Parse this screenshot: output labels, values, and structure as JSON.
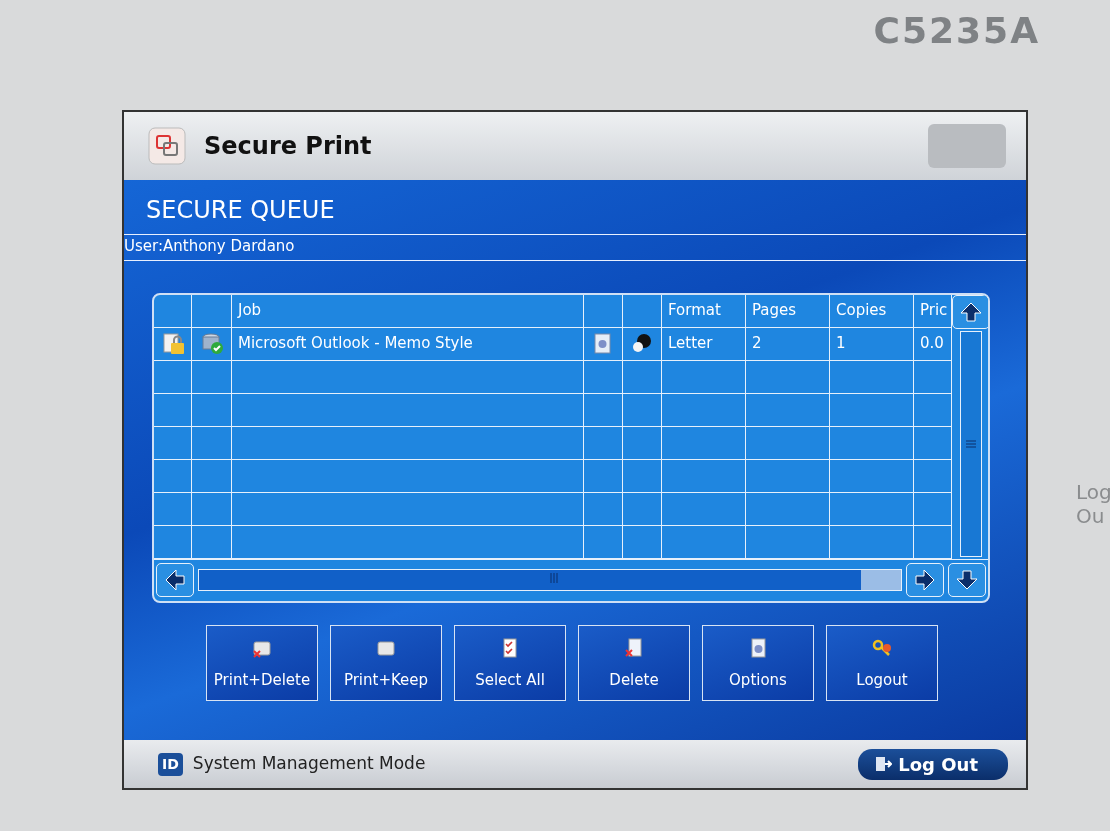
{
  "device": {
    "model": "C5235A",
    "side_text": [
      "Log",
      "Ou"
    ]
  },
  "header": {
    "title": "Secure Print"
  },
  "queue": {
    "title": "SECURE QUEUE",
    "user": "User:Anthony Dardano"
  },
  "table": {
    "columns": [
      {
        "kind": "icon"
      },
      {
        "kind": "icon"
      },
      {
        "kind": "text",
        "label": "Job"
      },
      {
        "kind": "icon"
      },
      {
        "kind": "icon"
      },
      {
        "kind": "text",
        "label": "Format"
      },
      {
        "kind": "text",
        "label": "Pages"
      },
      {
        "kind": "text",
        "label": "Copies"
      },
      {
        "kind": "text",
        "label": "Pric"
      }
    ],
    "rows": [
      {
        "cells": [
          {
            "kind": "icon"
          },
          {
            "kind": "icon"
          },
          {
            "kind": "text",
            "text": "Microsoft Outlook - Memo Style"
          },
          {
            "kind": "icon"
          },
          {
            "kind": "icon"
          },
          {
            "kind": "text",
            "text": "Letter"
          },
          {
            "kind": "text",
            "text": "2"
          },
          {
            "kind": "text",
            "text": "1"
          },
          {
            "kind": "text",
            "text": "0.0"
          }
        ]
      }
    ]
  },
  "buttons": [
    {
      "label": "Print+Delete"
    },
    {
      "label": "Print+Keep"
    },
    {
      "label": "Select All"
    },
    {
      "label": "Delete"
    },
    {
      "label": "Options"
    },
    {
      "label": "Logout"
    }
  ],
  "footer": {
    "badge": "ID",
    "mode": "System Management Mode",
    "logout": "Log Out"
  }
}
